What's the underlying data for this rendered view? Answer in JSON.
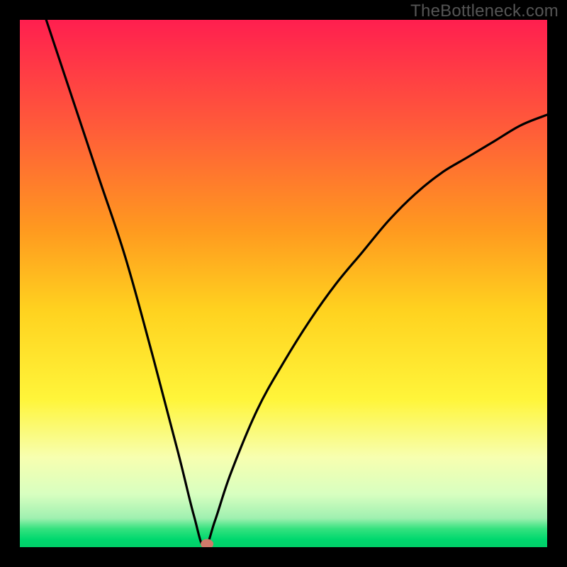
{
  "watermark": "TheBottleneck.com",
  "chart_data": {
    "type": "line",
    "title": "",
    "xlabel": "",
    "ylabel": "",
    "xlim": [
      0,
      100
    ],
    "ylim": [
      0,
      100
    ],
    "grid": false,
    "legend": false,
    "curve": {
      "min_x": 35,
      "points": [
        {
          "x": 5,
          "y": 100
        },
        {
          "x": 10,
          "y": 85
        },
        {
          "x": 15,
          "y": 70
        },
        {
          "x": 20,
          "y": 55
        },
        {
          "x": 25,
          "y": 37
        },
        {
          "x": 30,
          "y": 18
        },
        {
          "x": 33,
          "y": 6
        },
        {
          "x": 35,
          "y": 0
        },
        {
          "x": 37,
          "y": 5
        },
        {
          "x": 40,
          "y": 14
        },
        {
          "x": 45,
          "y": 26
        },
        {
          "x": 50,
          "y": 35
        },
        {
          "x": 55,
          "y": 43
        },
        {
          "x": 60,
          "y": 50
        },
        {
          "x": 65,
          "y": 56
        },
        {
          "x": 70,
          "y": 62
        },
        {
          "x": 75,
          "y": 67
        },
        {
          "x": 80,
          "y": 71
        },
        {
          "x": 85,
          "y": 74
        },
        {
          "x": 90,
          "y": 77
        },
        {
          "x": 95,
          "y": 80
        },
        {
          "x": 100,
          "y": 82
        }
      ]
    },
    "marker": {
      "x": 35.5,
      "y": 0.6,
      "color": "#cf7a6a"
    },
    "background_gradient": {
      "stops": [
        {
          "offset": 0.0,
          "color": "#ff1f4f"
        },
        {
          "offset": 0.2,
          "color": "#ff5a3a"
        },
        {
          "offset": 0.4,
          "color": "#ff9a1f"
        },
        {
          "offset": 0.55,
          "color": "#ffd21f"
        },
        {
          "offset": 0.72,
          "color": "#fff53a"
        },
        {
          "offset": 0.83,
          "color": "#f7ffb0"
        },
        {
          "offset": 0.9,
          "color": "#d8ffc0"
        },
        {
          "offset": 0.945,
          "color": "#9ff0b0"
        },
        {
          "offset": 0.965,
          "color": "#35e27f"
        },
        {
          "offset": 0.985,
          "color": "#00d86e"
        },
        {
          "offset": 1.0,
          "color": "#00cf68"
        }
      ]
    },
    "border_color": "#000000",
    "border_width": 28
  }
}
